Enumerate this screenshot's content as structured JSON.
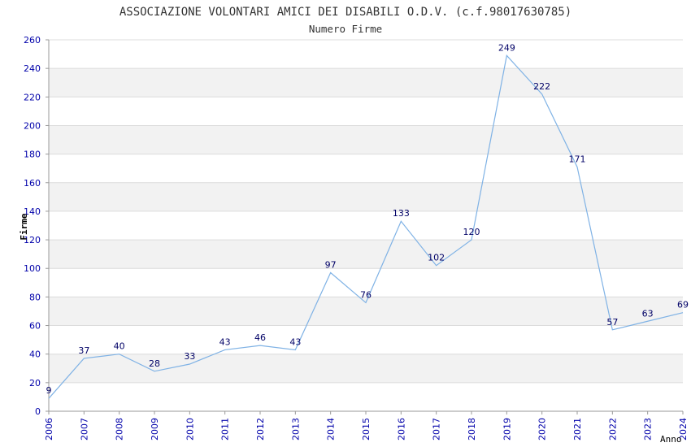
{
  "chart_data": {
    "type": "line",
    "title": "ASSOCIAZIONE VOLONTARI AMICI DEI DISABILI O.D.V. (c.f.98017630785)",
    "subtitle": "Numero Firme",
    "xlabel": "Anno",
    "ylabel": "Firme",
    "x": [
      "2006",
      "2007",
      "2008",
      "2009",
      "2010",
      "2011",
      "2012",
      "2013",
      "2014",
      "2015",
      "2016",
      "2017",
      "2018",
      "2019",
      "2020",
      "2021",
      "2022",
      "2023",
      "2024"
    ],
    "values": [
      9,
      37,
      40,
      28,
      33,
      43,
      46,
      43,
      97,
      76,
      133,
      102,
      120,
      249,
      222,
      171,
      57,
      63,
      69
    ],
    "ylim": [
      0,
      260
    ],
    "yticks": [
      0,
      20,
      40,
      60,
      80,
      100,
      120,
      140,
      160,
      180,
      200,
      220,
      240,
      260
    ],
    "grid": true,
    "colors": {
      "line": "#7fb2e5",
      "tick_text": "#0000aa",
      "data_label": "#000066",
      "band": "#f2f2f2",
      "gridline": "#dcdcdc",
      "title": "#333333"
    }
  }
}
